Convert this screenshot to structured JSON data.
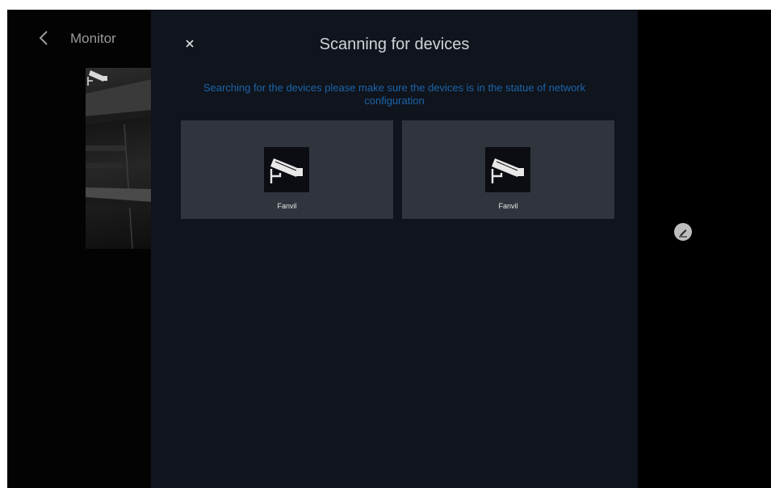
{
  "header": {
    "title": "Monitor",
    "back_icon": "chevron-left-icon",
    "refresh_icon": "refresh-icon"
  },
  "side": {
    "edit_icon": "edit-pencil-icon"
  },
  "dialog": {
    "close_icon": "close-icon",
    "title": "Scanning for devices",
    "message": "Searching for the devices please make sure the devices is in the statue of network configuration",
    "devices": [
      {
        "label": "Fanvil",
        "icon": "security-camera-icon"
      },
      {
        "label": "Fanvil",
        "icon": "security-camera-icon"
      }
    ]
  },
  "colors": {
    "dialog_bg": "#0f141d",
    "card_bg": "#30353d",
    "message_text": "#1d64a8",
    "title_text": "#cfd4da"
  }
}
